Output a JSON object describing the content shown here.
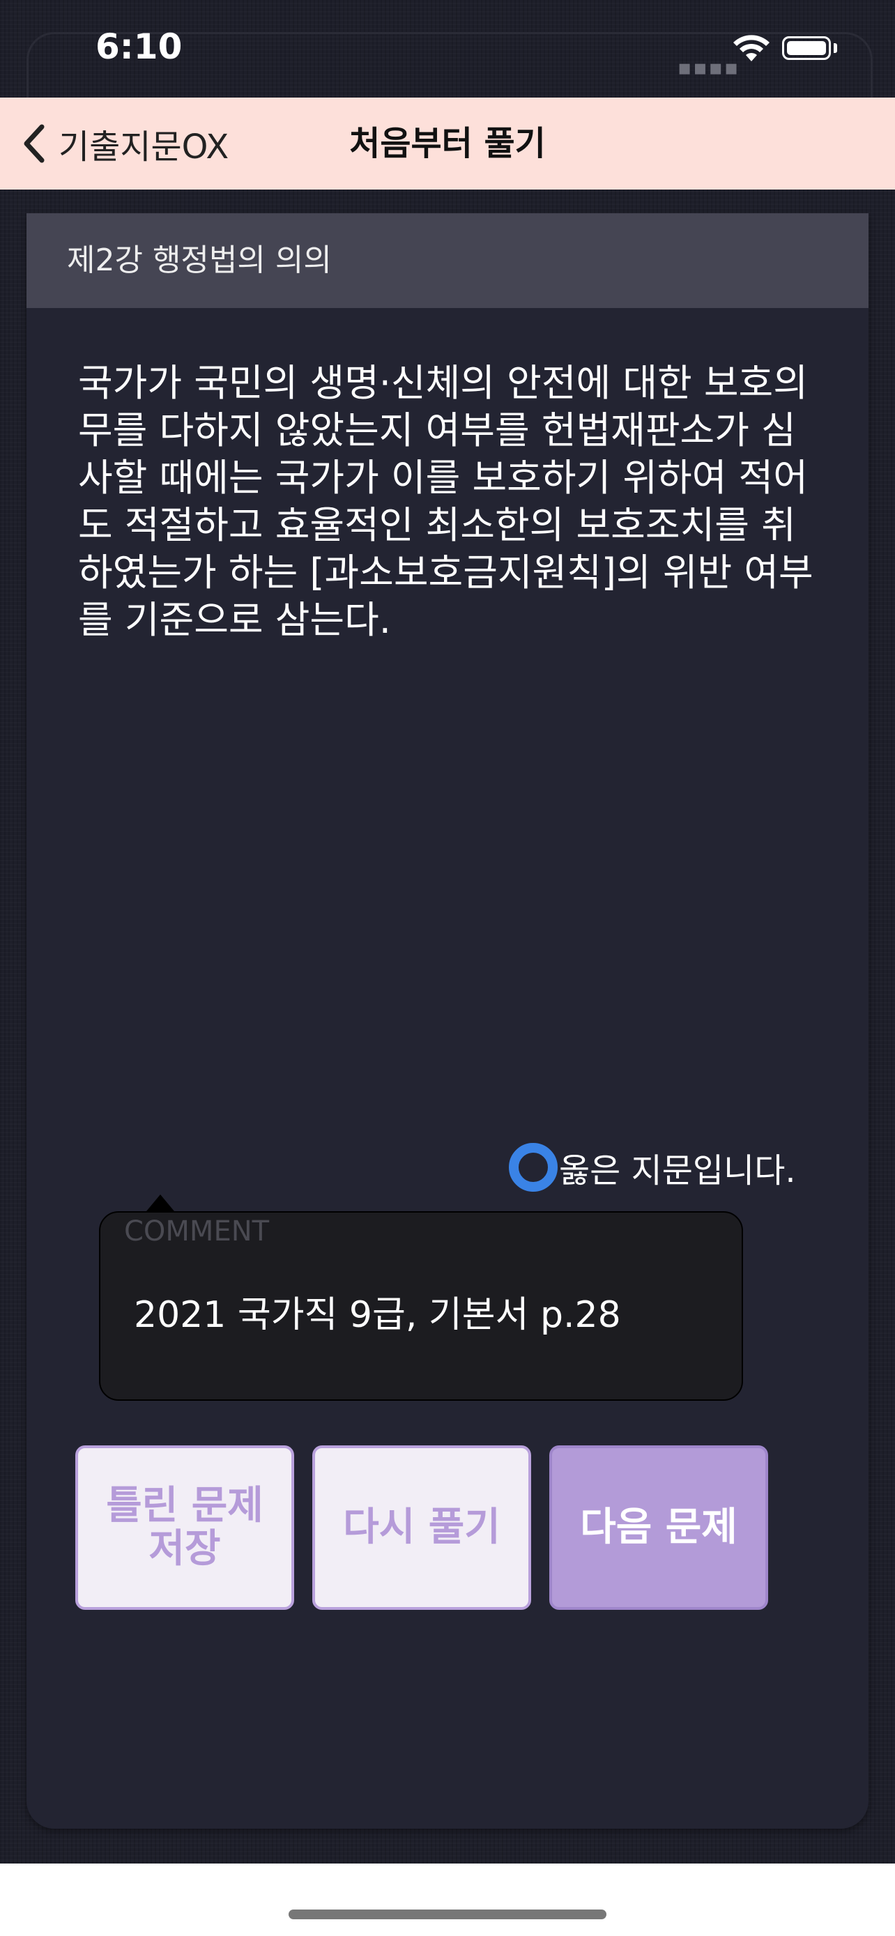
{
  "status_bar": {
    "time": "6:10",
    "icons": [
      "signal-icon",
      "wifi-icon",
      "battery-icon"
    ]
  },
  "nav": {
    "back_label": "기출지문OX",
    "title": "처음부터 풀기"
  },
  "chapter": {
    "title": "제2강 행정법의 의의"
  },
  "question": {
    "text": "국가가 국민의 생명·신체의 안전에 대한 보호의\n무를 다하지 않았는지 여부를 헌법재판소가 심\n사할 때에는 국가가 이를 보호하기 위하여 적어\n도 적절하고 효율적인 최소한의 보호조치를 취\n하였는가 하는 [과소보호금지원칙]의 위반 여부\n를 기준으로 삼는다."
  },
  "answer": {
    "icon": "circle-o-icon",
    "text": "옳은 지문입니다."
  },
  "comment": {
    "label": "COMMENT",
    "text": "2021 국가직 9급, 기본서 p.28"
  },
  "buttons": {
    "save_line1": "틀린 문제",
    "save_line2": "저장",
    "retry": "다시 풀기",
    "next": "다음 문제"
  },
  "colors": {
    "nav_background": "#fde0da",
    "card_background": "#232432",
    "chapter_header": "#454553",
    "answer_o": "#3a83e6",
    "button_light": "#f2eef6",
    "button_accent": "#b39bd8"
  }
}
